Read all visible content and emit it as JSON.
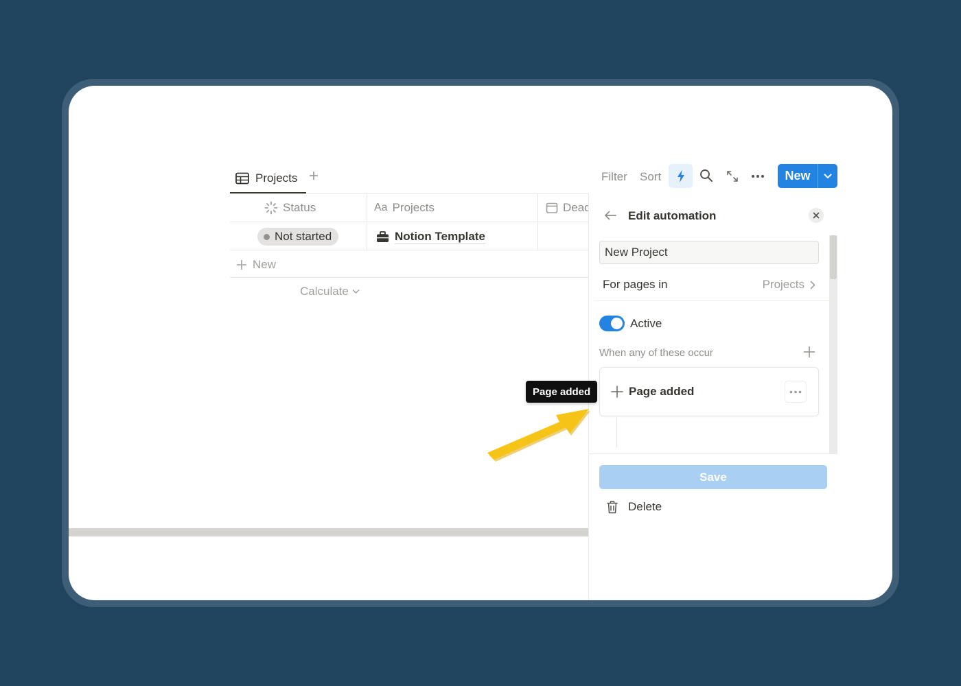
{
  "view": {
    "tab_label": "Projects",
    "add_view_symbol": "+"
  },
  "toolbar": {
    "filter": "Filter",
    "sort": "Sort",
    "new_button": "New",
    "accent": "#2383e2"
  },
  "table": {
    "columns": [
      {
        "label": "Status",
        "icon": "status-spinner-icon"
      },
      {
        "label": "Projects",
        "icon": "text-aa-icon",
        "prefix": "Aa"
      },
      {
        "label": "Dead",
        "icon": "calendar-icon"
      }
    ],
    "rows": [
      {
        "status": "Not started",
        "project": "Notion Template",
        "project_icon": "briefcase-icon"
      }
    ],
    "new_row": "New",
    "calculate": "Calculate"
  },
  "automation_panel": {
    "title": "Edit automation",
    "name_value": "New Project",
    "for_pages_label": "For pages in",
    "for_pages_value": "Projects",
    "active_label": "Active",
    "active": true,
    "triggers_heading": "When any of these occur",
    "trigger_label": "Page added",
    "save_label": "Save",
    "delete_label": "Delete"
  },
  "tooltip": {
    "text": "Page added"
  },
  "annotation": {
    "arrow_color": "#f5c417"
  }
}
